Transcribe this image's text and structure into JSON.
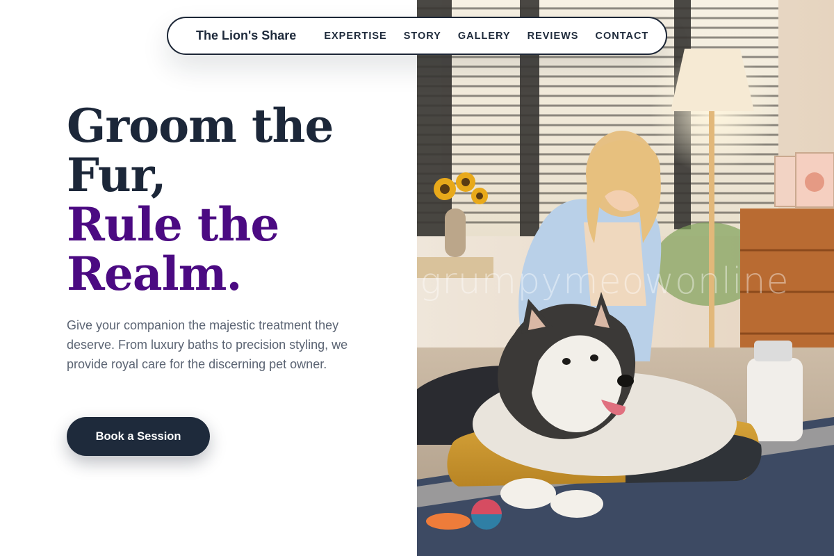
{
  "nav": {
    "brand": "The Lion's Share",
    "links": [
      "EXPERTISE",
      "STORY",
      "GALLERY",
      "REVIEWS",
      "CONTACT"
    ]
  },
  "hero": {
    "headline_line1": "Groom the",
    "headline_line2": "Fur,",
    "headline_line3": "Rule the",
    "headline_line4": "Realm.",
    "subcopy": "Give your companion the majestic treatment they deserve. From luxury baths to precision styling, we provide royal care for the discerning pet owner.",
    "cta_label": "Book a Session"
  },
  "photo": {
    "description_icon": "woman-grooming-husky-photo",
    "watermark": "grumpymeowonline"
  },
  "colors": {
    "navy": "#1e2a3b",
    "royal_purple": "#4b0a82",
    "body_text": "#5b6473",
    "background": "#ffffff"
  }
}
